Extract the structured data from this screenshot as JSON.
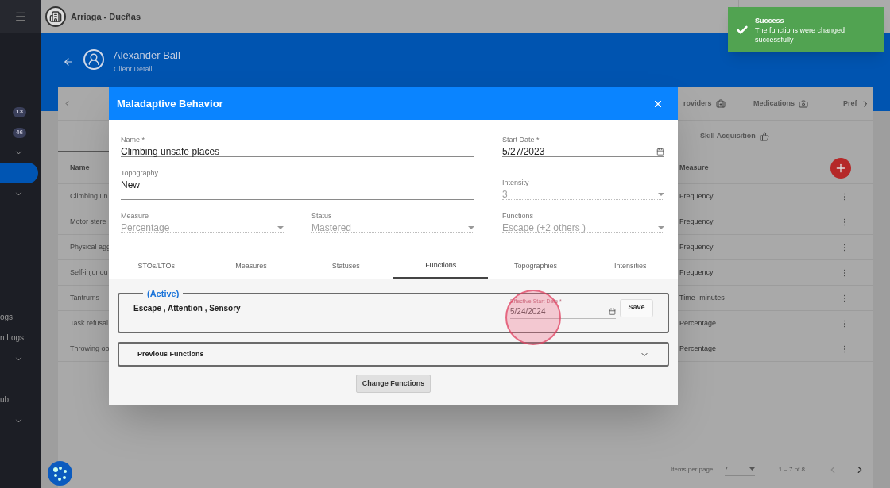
{
  "app": {
    "brand": "Arriaga - Dueñas"
  },
  "sidebar": {
    "badges": [
      "13",
      "46"
    ],
    "labels": [
      "ogs",
      "n Logs",
      "ub"
    ]
  },
  "header": {
    "title": "Alexander Ball",
    "subtitle": "Client Detail"
  },
  "client_tabs": [
    {
      "label": "roviders",
      "selected": false
    },
    {
      "label": "Medications",
      "selected": false
    },
    {
      "label": "Pref",
      "selected": false
    }
  ],
  "section_tabs": [
    {
      "label": "Skill Acquisition",
      "selected": false
    }
  ],
  "table": {
    "columns": [
      "Name",
      "Measure"
    ],
    "rows": [
      {
        "name": "Climbing un",
        "measure": "Frequency"
      },
      {
        "name": "Motor stere",
        "measure": "Frequency"
      },
      {
        "name": "Physical agg",
        "measure": "Frequency"
      },
      {
        "name": "Self-injuriou",
        "measure": "Frequency"
      },
      {
        "name": "Tantrums",
        "measure": "Time -minutes-"
      },
      {
        "name": "Task refusal",
        "measure": "Percentage"
      },
      {
        "name": "Throwing ob",
        "measure": "Percentage"
      }
    ]
  },
  "paginator": {
    "label": "Items per page:",
    "page_size": "7",
    "range": "1 – 7 of 8"
  },
  "toast": {
    "title": "Success",
    "message": "The functions were changed successfully"
  },
  "dialog": {
    "title": "Maladaptive Behavior",
    "fields": [
      {
        "kind": "text",
        "label": "Name *",
        "value": "Climbing unsafe places",
        "disabled": false
      },
      {
        "kind": "date",
        "label": "Start Date *",
        "value": "5/27/2023",
        "disabled": false
      },
      {
        "kind": "textarea",
        "label": "Topography",
        "value": "New",
        "disabled": false
      },
      {
        "kind": "select",
        "label": "Intensity",
        "value": "3",
        "disabled": true
      },
      {
        "kind": "select",
        "label": "Measure",
        "value": "Percentage",
        "disabled": true
      },
      {
        "kind": "select",
        "label": "Status",
        "value": "Mastered",
        "disabled": true
      },
      {
        "kind": "select",
        "label": "Functions",
        "value": "Escape (+2 others )",
        "disabled": true
      }
    ],
    "tabs": [
      {
        "label": "STOs/LTOs",
        "selected": false
      },
      {
        "label": "Measures",
        "selected": false
      },
      {
        "label": "Statuses",
        "selected": false
      },
      {
        "label": "Functions",
        "selected": true
      },
      {
        "label": "Topographies",
        "selected": false
      },
      {
        "label": "Intensities",
        "selected": false
      }
    ],
    "active": {
      "legend": "(Active)",
      "functions": "Escape , Attention , Sensory",
      "date_label": "Effective Start Date *",
      "date_value": "5/24/2024",
      "save": "Save"
    },
    "previous": {
      "label": "Previous Functions",
      "expanded": false
    },
    "change_button": "Change Functions"
  }
}
